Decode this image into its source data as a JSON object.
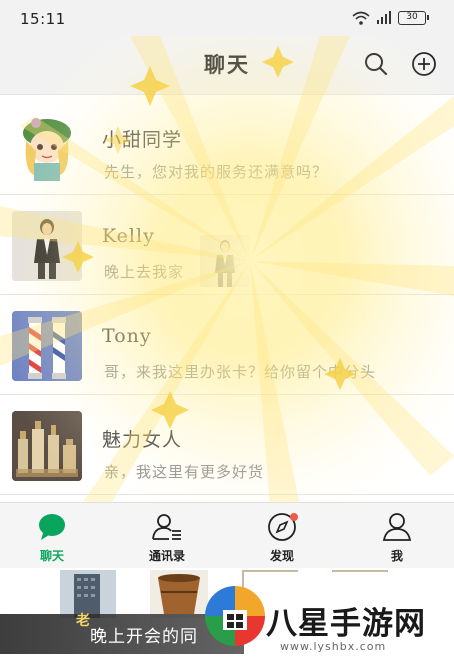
{
  "status_bar": {
    "time": "15:11",
    "battery": "30"
  },
  "header": {
    "title": "聊天"
  },
  "chats": [
    {
      "name": "小甜同学",
      "message": "先生，您对我的服务还满意吗？",
      "avatar": "cartoon-girl-avatar"
    },
    {
      "name": "Kelly",
      "message": "晚上去我家",
      "avatar": "woman-photo-avatar"
    },
    {
      "name": "Tony",
      "message": "哥，来我这里办张卡？给你留个中分头",
      "avatar": "barber-pole-avatar"
    },
    {
      "name": "魅力女人",
      "message": "亲，我这里有更多好货",
      "avatar": "cosmetics-avatar"
    }
  ],
  "tabs": [
    {
      "label": "聊天",
      "icon": "chat-bubble-icon",
      "active": true
    },
    {
      "label": "通讯录",
      "icon": "contacts-icon",
      "active": false
    },
    {
      "label": "发现",
      "icon": "compass-icon",
      "active": false,
      "badge": true
    },
    {
      "label": "我",
      "icon": "person-icon",
      "active": false
    }
  ],
  "bottom_strip": {
    "caption": "晚上开会的同",
    "caption_prefix": "老"
  },
  "watermark": {
    "text": "八星手游网",
    "url": "www.lyshbx.com"
  },
  "colors": {
    "accent": "#09a55c",
    "badge": "#f0584a",
    "burst": "#ffe77a"
  }
}
